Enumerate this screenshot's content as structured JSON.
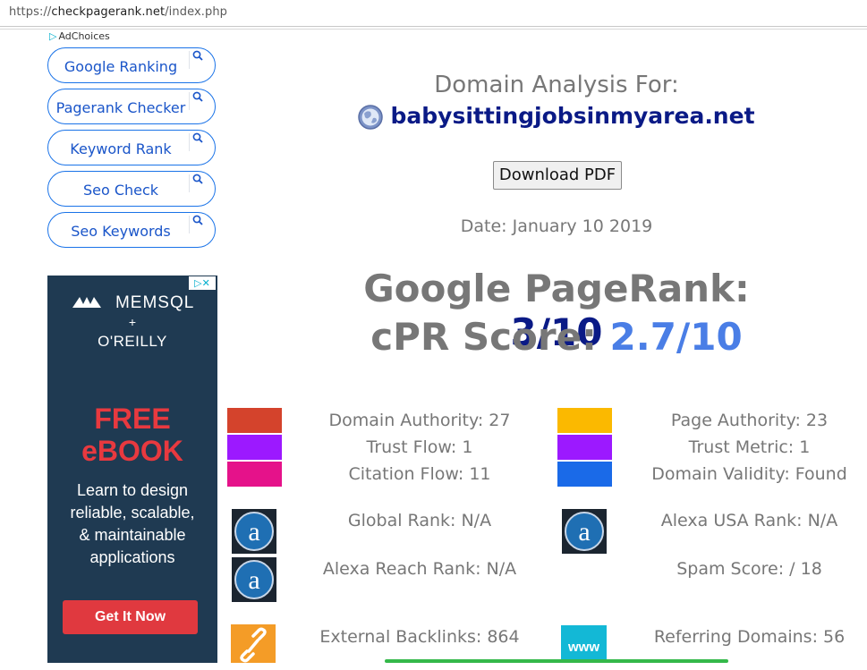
{
  "browser": {
    "url_scheme": "https://",
    "url_domain": "checkpagerank.net",
    "url_path": "/index.php"
  },
  "sidebar": {
    "adchoices": "AdChoices",
    "buttons": [
      "Google Ranking",
      "Pagerank Checker",
      "Keyword Rank",
      "Seo Check",
      "Seo Keywords"
    ]
  },
  "ad": {
    "brand1": "MEMSQL",
    "plus": "+",
    "brand2": "O'REILLY",
    "headline1": "FREE",
    "headline2": "eBOOK",
    "body": [
      "Learn to design",
      "reliable, scalable,",
      "& maintainable",
      "applications"
    ],
    "cta": "Get It Now",
    "close_label": "▷✕"
  },
  "analysis": {
    "title": "Domain Analysis For:",
    "domain": "babysittingjobsinmyarea.net",
    "download": "Download PDF",
    "date": "Date: January 10 2019",
    "pagerank_label": "Google PageRank: ",
    "pagerank_value": "3/10",
    "cpr_label": "cPR Score: ",
    "cpr_value": "2.7/10"
  },
  "metrics": {
    "left": [
      {
        "label": "Domain Authority: 27",
        "color": "#d4432c"
      },
      {
        "label": "Trust Flow: 1",
        "color": "#9c19ff"
      },
      {
        "label": "Citation Flow: 11",
        "color": "#e5128a"
      }
    ],
    "right": [
      {
        "label": "Page Authority: 23",
        "color": "#fbb900"
      },
      {
        "label": "Trust Metric: 1",
        "color": "#9c19ff"
      },
      {
        "label": "Domain Validity: Found",
        "color": "#1a6ae8"
      }
    ],
    "global_rank": "Global Rank: N/A",
    "alexa_usa": "Alexa USA Rank: N/A",
    "alexa_reach": "Alexa Reach Rank: N/A",
    "spam_score": "Spam Score: / 18",
    "backlinks": "External Backlinks: 864",
    "referring": "Referring Domains: 56",
    "www_badge": "www"
  }
}
